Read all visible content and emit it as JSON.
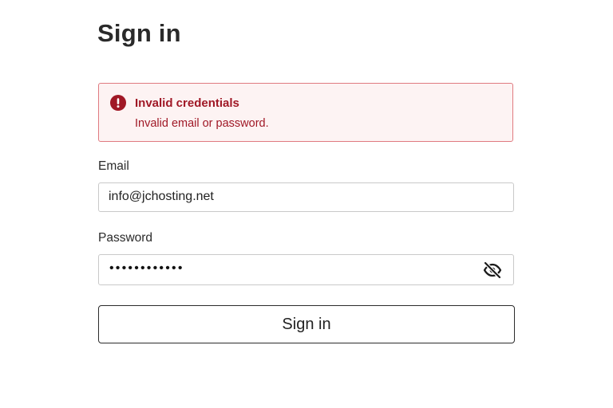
{
  "page": {
    "title": "Sign in"
  },
  "alert": {
    "icon": "exclamation-circle-icon",
    "title": "Invalid credentials",
    "message": "Invalid email or password.",
    "color": "#a01826"
  },
  "email": {
    "label": "Email",
    "value": "info@jchosting.net"
  },
  "password": {
    "label": "Password",
    "masked_value": "••••••••••••",
    "toggle_icon": "eye-slash-icon"
  },
  "submit": {
    "label": "Sign in"
  }
}
